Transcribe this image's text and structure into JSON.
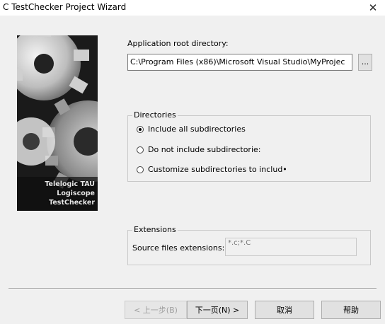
{
  "window": {
    "title": "C TestChecker Project Wizard",
    "close_glyph": "✕"
  },
  "sidebar": {
    "brand_line1": "Telelogic TAU",
    "brand_line2": "Logiscope",
    "brand_line3": "TestChecker"
  },
  "root_dir": {
    "label": "Application root directory:",
    "value": "C:\\Program Files (x86)\\Microsoft Visual Studio\\MyProjec",
    "browse_label": "..."
  },
  "directories": {
    "group_label": "Directories",
    "options": [
      {
        "label": "Include all subdirectories",
        "checked": true
      },
      {
        "label": "Do not include subdirectorie:",
        "checked": false
      },
      {
        "label": "Customize subdirectories to includ•",
        "checked": false
      }
    ]
  },
  "extensions": {
    "group_label": "Extensions",
    "field_label": "Source files extensions:",
    "field_value": "*.c;*.C"
  },
  "buttons": {
    "back": "< 上一步(B)",
    "next": "下一页(N) >",
    "cancel": "取消",
    "help": "帮助"
  }
}
